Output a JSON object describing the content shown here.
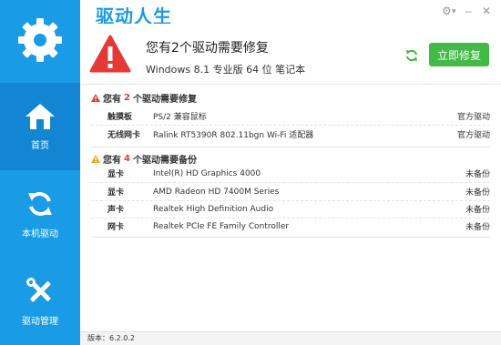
{
  "app": {
    "title": "驱动人生",
    "window_controls": [
      "⚙",
      "▾",
      "–",
      "✕"
    ]
  },
  "sidebar": {
    "items": [
      {
        "label": "首页",
        "icon": "home-icon"
      },
      {
        "label": "本机驱动",
        "icon": "refresh-icon"
      },
      {
        "label": "驱动管理",
        "icon": "tools-icon"
      }
    ],
    "active_index": 0
  },
  "header": {
    "title": "您有2个驱动需要修复",
    "subtitle": "Windows 8.1 专业版 64 位 笔记本",
    "repair_button": "立即修复"
  },
  "sections": [
    {
      "title_prefix": "您有",
      "count": "2",
      "title_suffix": "个驱动需要修复",
      "icon": "red-warning-icon",
      "rows": [
        {
          "type": "触摸板",
          "name": "PS/2 兼容鼠标",
          "status": "官方驱动"
        },
        {
          "type": "无线网卡",
          "name": "Ralink RT5390R 802.11bgn Wi-Fi 适配器",
          "status": "官方驱动"
        }
      ]
    },
    {
      "title_prefix": "您有",
      "count": "4",
      "title_suffix": "个驱动需要备份",
      "icon": "orange-warning-icon",
      "rows": [
        {
          "type": "显卡",
          "name": "Intel(R) HD Graphics 4000",
          "status": "未备份"
        },
        {
          "type": "显卡",
          "name": "AMD Radeon HD 7400M Series",
          "status": "未备份"
        },
        {
          "type": "声卡",
          "name": "Realtek High Definition Audio",
          "status": "未备份"
        },
        {
          "type": "网卡",
          "name": "Realtek PCIe FE Family Controller",
          "status": "未备份"
        }
      ]
    }
  ],
  "footer": {
    "version": "版本：6.2.0.2"
  },
  "colors": {
    "sidebar": "#1a9be6",
    "sidebar_active": "#1286d2",
    "accent_green": "#43b947",
    "warning_red": "#e53935",
    "warning_orange": "#f5a623"
  }
}
